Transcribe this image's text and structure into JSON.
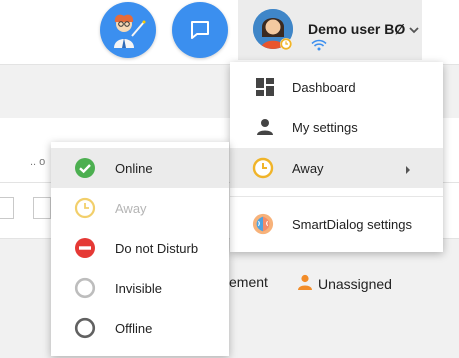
{
  "user": {
    "name": "Demo user BØ"
  },
  "background": {
    "truncated_label": ".. o",
    "assignment_partial": "ement",
    "unassigned_label": "Unassigned"
  },
  "main_menu": {
    "items": [
      {
        "label": "Dashboard",
        "icon": "dashboard-icon"
      },
      {
        "label": "My settings",
        "icon": "person-icon"
      },
      {
        "label": "Away",
        "icon": "clock-icon",
        "has_submenu": true
      },
      {
        "label": "SmartDialog settings",
        "icon": "brain-icon"
      }
    ]
  },
  "status_menu": {
    "items": [
      {
        "label": "Online",
        "icon": "check-circle-icon",
        "color": "#4caf50",
        "highlighted": true
      },
      {
        "label": "Away",
        "icon": "clock-icon",
        "color": "#f2cf6b",
        "disabled": true
      },
      {
        "label": "Do not Disturb",
        "icon": "do-not-disturb-icon",
        "color": "#e53935"
      },
      {
        "label": "Invisible",
        "icon": "empty-circle-icon",
        "color": "#bdbdbd"
      },
      {
        "label": "Offline",
        "icon": "empty-circle-icon",
        "color": "#616161"
      }
    ]
  },
  "colors": {
    "accent_blue": "#3b8fef",
    "away_yellow": "#f0b429",
    "unassigned_orange": "#f28c28"
  }
}
